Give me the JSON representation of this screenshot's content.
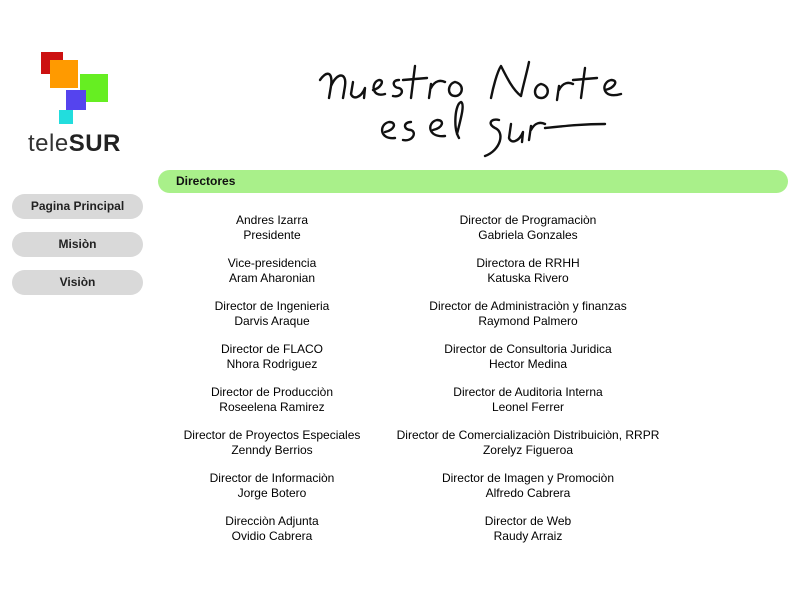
{
  "brand": {
    "logo_text_light": "tele",
    "logo_text_bold": "SUR",
    "slogan": "nuestro Norte es el Sur",
    "colors": {
      "red": "#cc1111",
      "orange": "#ff9a00",
      "green": "#66ee22",
      "blue": "#5544ee",
      "cyan": "#22dddd",
      "section_bar": "#a9f08a",
      "nav_button": "#d9d9d9"
    }
  },
  "nav": {
    "items": [
      {
        "label": "Pagina Principal"
      },
      {
        "label": "Misiòn"
      },
      {
        "label": "Visiòn"
      }
    ]
  },
  "section": {
    "title": "Directores"
  },
  "directors": {
    "left": [
      {
        "role": "Andres Izarra",
        "name": "Presidente"
      },
      {
        "role": "Vice-presidencia",
        "name": "Aram Aharonian"
      },
      {
        "role": "Director de Ingenieria",
        "name": "Darvis Araque"
      },
      {
        "role": "Director de FLACO",
        "name": "Nhora Rodriguez"
      },
      {
        "role": "Director de Producciòn",
        "name": "Roseelena Ramirez"
      },
      {
        "role": "Director de Proyectos Especiales",
        "name": "Zenndy Berrios"
      },
      {
        "role": "Director de Informaciòn",
        "name": "Jorge Botero"
      },
      {
        "role": "Direcciòn Adjunta",
        "name": "Ovidio Cabrera"
      }
    ],
    "right": [
      {
        "role": "Director de Programaciòn",
        "name": "Gabriela Gonzales"
      },
      {
        "role": "Directora de RRHH",
        "name": "Katuska Rivero"
      },
      {
        "role": "Director de Administraciòn y finanzas",
        "name": "Raymond Palmero"
      },
      {
        "role": "Director de Consultoria Juridica",
        "name": "Hector Medina"
      },
      {
        "role": "Director de Auditoria Interna",
        "name": "Leonel Ferrer"
      },
      {
        "role": "Director de Comercializaciòn Distribuiciòn, RRPR",
        "name": "Zorelyz Figueroa"
      },
      {
        "role": "Director de Imagen y Promociòn",
        "name": "Alfredo Cabrera"
      },
      {
        "role": "Director de Web",
        "name": "Raudy Arraiz"
      }
    ]
  }
}
